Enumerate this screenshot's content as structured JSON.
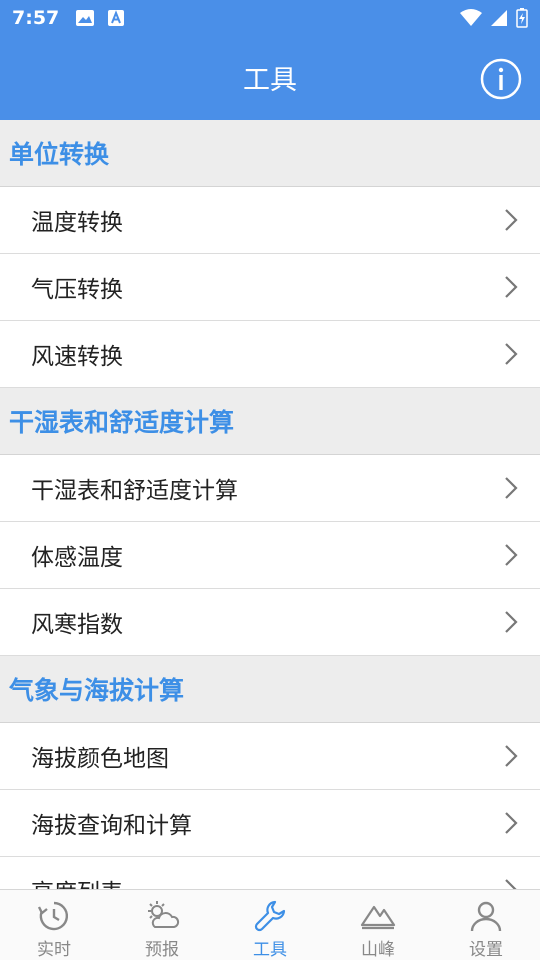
{
  "status_bar": {
    "time": "7:57"
  },
  "header": {
    "title": "工具"
  },
  "sections": [
    {
      "title": "单位转换",
      "items": [
        "温度转换",
        "气压转换",
        "风速转换"
      ]
    },
    {
      "title": "干湿表和舒适度计算",
      "items": [
        "干湿表和舒适度计算",
        "体感温度",
        "风寒指数"
      ]
    },
    {
      "title": "气象与海拔计算",
      "items": [
        "海拔颜色地图",
        "海拔查询和计算",
        "高度列表"
      ]
    }
  ],
  "tabs": [
    {
      "label": "实时",
      "icon": "clock-refresh-icon"
    },
    {
      "label": "预报",
      "icon": "sun-cloud-icon"
    },
    {
      "label": "工具",
      "icon": "wrench-icon",
      "active": true
    },
    {
      "label": "山峰",
      "icon": "mountain-icon"
    },
    {
      "label": "设置",
      "icon": "person-icon"
    }
  ],
  "colors": {
    "primary": "#4a8fe8",
    "accent_text": "#3d8fe6",
    "section_bg": "#ededed"
  }
}
